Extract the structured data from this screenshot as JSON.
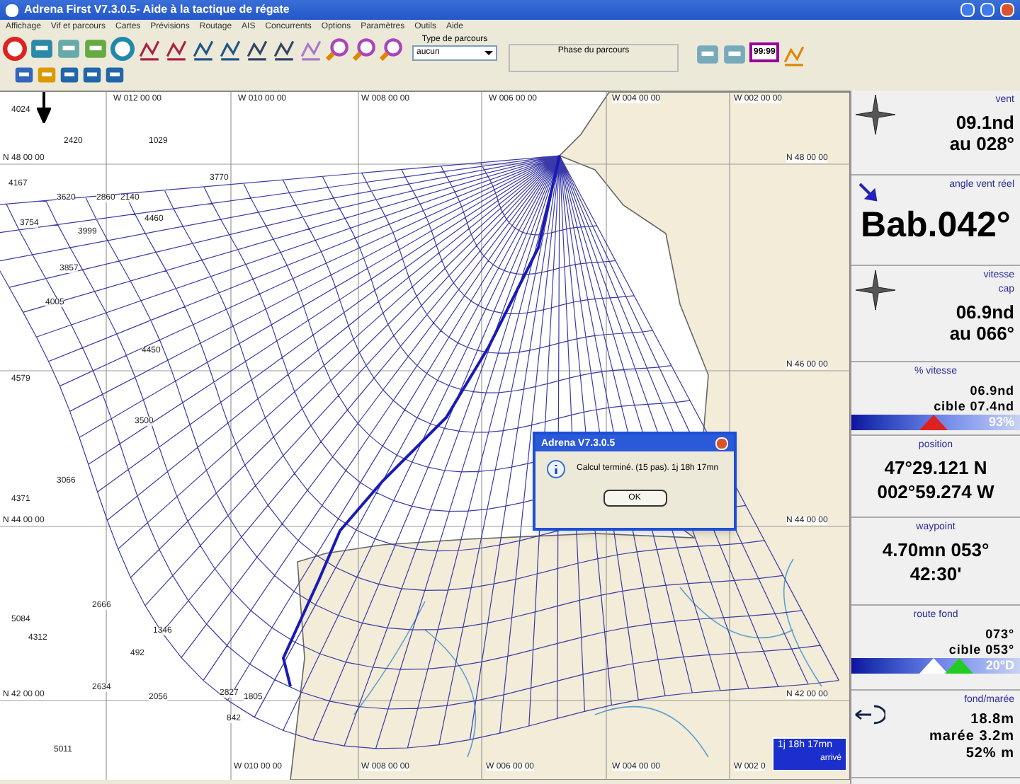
{
  "window": {
    "title": "Adrena First V7.3.0.5- Aide à la tactique de régate"
  },
  "menu": [
    "Affichage",
    "Vif et parcours",
    "Cartes",
    "Prévisions",
    "Routage",
    "AIS",
    "Concurrents",
    "Options",
    "Paramètres",
    "Outils",
    "Aide"
  ],
  "toolbar": {
    "course_type": {
      "label": "Type de parcours",
      "value": "aucun"
    },
    "course_phase": {
      "label": "Phase du parcours"
    },
    "timer_icon": "99:99"
  },
  "map": {
    "top_labels": [
      "W 012 00 00",
      "W 010 00 00",
      "W 008 00 00",
      "W 006 00 00",
      "W 004 00 00",
      "W 002 00 00"
    ],
    "bottom_labels": [
      "W 010 00 00",
      "W 008 00 00",
      "W 006 00 00",
      "W 004 00 00",
      "W 002 0"
    ],
    "left_labels": [
      "N 48 00 00",
      "N 44 00 00",
      "N 42 00 00"
    ],
    "right_labels": [
      "N 48 00 00",
      "N 46 00 00",
      "N 44 00 00",
      "N 42 00 00"
    ],
    "soundings": [
      "4024",
      "2420",
      "1029",
      "3770",
      "4167",
      "3620",
      "2860",
      "2140",
      "3754",
      "3999",
      "4460",
      "3857",
      "4005",
      "4450",
      "4579",
      "3500",
      "4371",
      "3066",
      "5084",
      "4312",
      "492",
      "1346",
      "2666",
      "2634",
      "2056",
      "842",
      "5011",
      "2827",
      "1805"
    ],
    "arrival": {
      "time": "1j 18h 17mn",
      "label": "arrivé"
    }
  },
  "dialog": {
    "title": "Adrena V7.3.0.5",
    "message": "Calcul terminé. (15 pas). 1j 18h 17mn",
    "button": "OK"
  },
  "panel": [
    {
      "kind": "values",
      "labels": [
        "vent"
      ],
      "values": [
        "09.1nd",
        "au 028°"
      ]
    },
    {
      "kind": "big",
      "labels": [
        "angle vent réel"
      ],
      "values": [
        "Bab.042°"
      ]
    },
    {
      "kind": "values",
      "labels": [
        "vitesse",
        "cap"
      ],
      "values": [
        "06.9nd",
        "au 066°"
      ]
    },
    {
      "kind": "bar",
      "labels": [
        "% vitesse"
      ],
      "values": [
        "06.9nd",
        "cible 07.4nd"
      ],
      "bar": "93%"
    },
    {
      "kind": "center",
      "labels": [
        "position"
      ],
      "values": [
        "47°29.121 N",
        "002°59.274 W"
      ]
    },
    {
      "kind": "center",
      "labels": [
        "waypoint"
      ],
      "values": [
        "4.70mn 053°",
        "42:30'"
      ]
    },
    {
      "kind": "bar2",
      "labels": [
        "route fond"
      ],
      "values": [
        "073°",
        "cible 053°"
      ],
      "bar": "20°D"
    },
    {
      "kind": "values",
      "labels": [
        "fond/marée"
      ],
      "values": [
        "18.8m",
        "marée 3.2m",
        "52% m"
      ]
    }
  ]
}
